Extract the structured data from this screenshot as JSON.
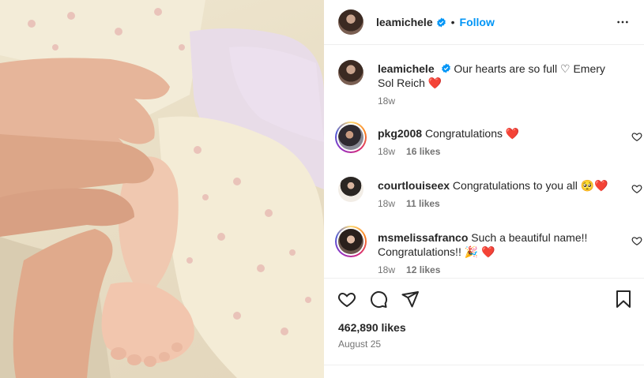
{
  "post": {
    "username": "leamichele",
    "follow_label": "Follow",
    "separator": "•"
  },
  "caption": {
    "username": "leamichele",
    "text": "Our hearts are so full ♡ Emery Sol Reich ❤️",
    "age": "18w"
  },
  "comments": [
    {
      "username": "pkg2008",
      "text": "Congratulations ❤️",
      "age": "18w",
      "likes": "16 likes"
    },
    {
      "username": "courtlouiseex",
      "text": "Congratulations to you all 🥺❤️",
      "age": "18w",
      "likes": "11 likes"
    },
    {
      "username": "msmelissafranco",
      "text": "Such a beautiful name!! Congratulations!! 🎉 ❤️",
      "age": "18w",
      "likes": "12 likes"
    }
  ],
  "footer": {
    "likes": "462,890 likes",
    "date": "August 25"
  },
  "icons": {
    "verified": "verified-badge-icon",
    "more": "more-options-icon",
    "like": "heart-icon",
    "comment": "comment-icon",
    "share": "share-icon",
    "save": "bookmark-icon"
  },
  "colors": {
    "accent": "#0095f6",
    "secondary_text": "#737373",
    "divider": "#efefef"
  }
}
